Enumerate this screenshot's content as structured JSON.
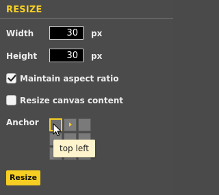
{
  "panel": {
    "title": "RESIZE"
  },
  "width": {
    "label": "Width",
    "value": "30",
    "unit": "px"
  },
  "height": {
    "label": "Height",
    "value": "30",
    "unit": "px"
  },
  "maintain_aspect": {
    "label": "Maintain aspect ratio",
    "checked": true
  },
  "resize_canvas": {
    "label": "Resize canvas content",
    "checked": false
  },
  "anchor": {
    "label": "Anchor",
    "selected": "top left"
  },
  "tooltip": {
    "text": "top left"
  },
  "resize_button": {
    "label": "Resize"
  },
  "colors": {
    "accent": "#f6cf22",
    "background": "#4b4b4b"
  }
}
